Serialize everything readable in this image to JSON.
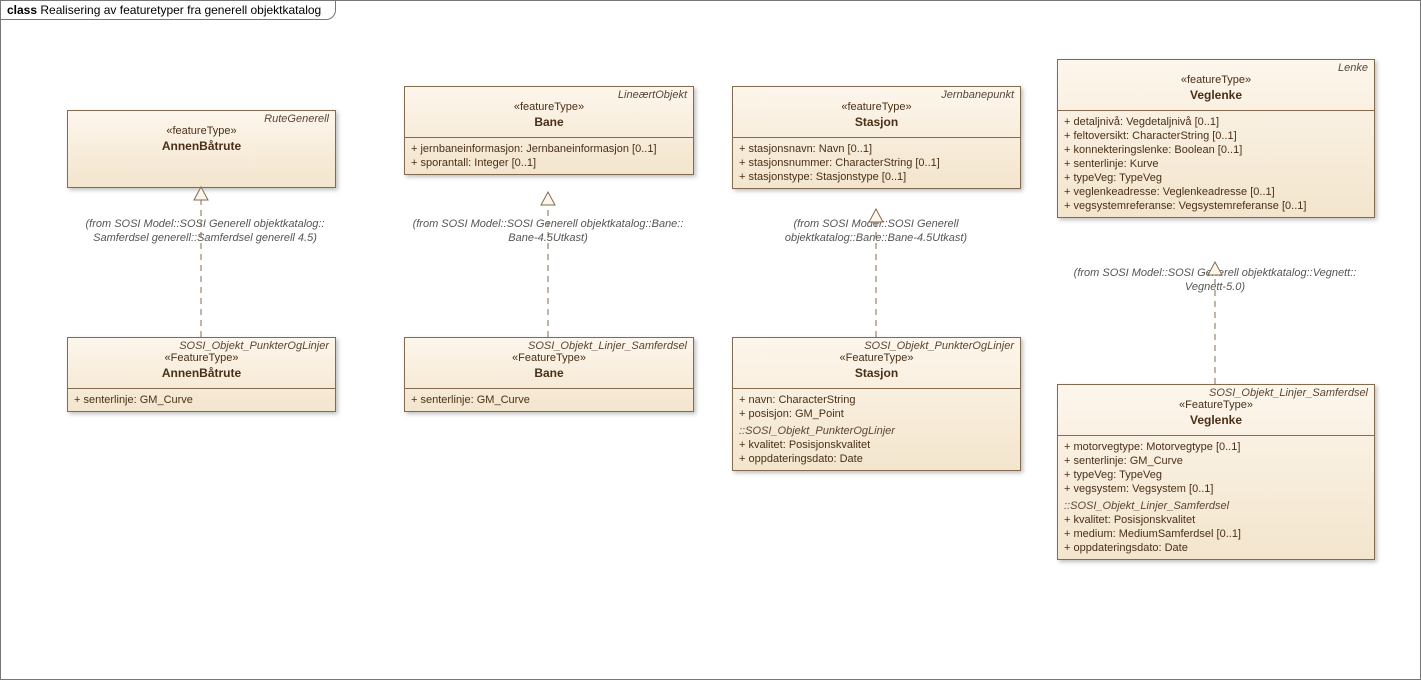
{
  "frame": {
    "kind": "class",
    "title": "Realisering av featuretyper fra generell objektkatalog"
  },
  "boxes": {
    "annenBatruteTop": {
      "corner": "RuteGenerell",
      "stereo": "«featureType»",
      "name": "AnnenBåtrute"
    },
    "annenBatruteFrom": "(from SOSI Model::SOSI Generell objektkatalog::\nSamferdsel generell::Samferdsel generell 4.5)",
    "annenBatruteBot": {
      "corner": "SOSI_Objekt_PunkterOgLinjer",
      "stereo": "«FeatureType»",
      "name": "AnnenBåtrute",
      "attrs": [
        "+    senterlinje: GM_Curve"
      ]
    },
    "baneTop": {
      "corner": "LineærtObjekt",
      "stereo": "«featureType»",
      "name": "Bane",
      "attrs": [
        "+    jernbaneinformasjon: Jernbaneinformasjon [0..1]",
        "+    sporantall: Integer [0..1]"
      ]
    },
    "baneFrom": "(from SOSI Model::SOSI Generell objektkatalog::Bane::\nBane-4.5Utkast)",
    "baneBot": {
      "corner": "SOSI_Objekt_Linjer_Samferdsel",
      "stereo": "«FeatureType»",
      "name": "Bane",
      "attrs": [
        "+    senterlinje: GM_Curve"
      ]
    },
    "stasjonTop": {
      "corner": "Jernbanepunkt",
      "stereo": "«featureType»",
      "name": "Stasjon",
      "attrs": [
        "+    stasjonsnavn: Navn [0..1]",
        "+    stasjonsnummer: CharacterString [0..1]",
        "+    stasjonstype: Stasjonstype [0..1]"
      ]
    },
    "stasjonFrom": "(from SOSI Model::SOSI Generell\nobjektkatalog::Bane::Bane-4.5Utkast)",
    "stasjonBot": {
      "corner": "SOSI_Objekt_PunkterOgLinjer",
      "stereo": "«FeatureType»",
      "name": "Stasjon",
      "attrs": [
        "+    navn: CharacterString",
        "+    posisjon: GM_Point"
      ],
      "subhead": "::SOSI_Objekt_PunkterOgLinjer",
      "subattrs": [
        "+    kvalitet: Posisjonskvalitet",
        "+    oppdateringsdato: Date"
      ]
    },
    "veglenkeTop": {
      "corner": "Lenke",
      "stereo": "«featureType»",
      "name": "Veglenke",
      "attrs": [
        "+    detaljnivå: Vegdetaljnivå [0..1]",
        "+    feltoversikt: CharacterString [0..1]",
        "+    konnekteringslenke: Boolean [0..1]",
        "+    senterlinje: Kurve",
        "+    typeVeg: TypeVeg",
        "+    veglenkeadresse: Veglenkeadresse [0..1]",
        "+    vegsystemreferanse: Vegsystemreferanse [0..1]"
      ]
    },
    "veglenkeFrom": "(from SOSI Model::SOSI Generell objektkatalog::Vegnett::\nVegnett-5.0)",
    "veglenkeBot": {
      "corner": "SOSI_Objekt_Linjer_Samferdsel",
      "stereo": "«FeatureType»",
      "name": "Veglenke",
      "attrs": [
        "+    motorvegtype: Motorvegtype [0..1]",
        "+    senterlinje: GM_Curve",
        "+    typeVeg: TypeVeg",
        "+    vegsystem: Vegsystem [0..1]"
      ],
      "subhead": "::SOSI_Objekt_Linjer_Samferdsel",
      "subattrs": [
        "+    kvalitet: Posisjonskvalitet",
        "+    medium: MediumSamferdsel [0..1]",
        "+    oppdateringsdato: Date"
      ]
    }
  }
}
